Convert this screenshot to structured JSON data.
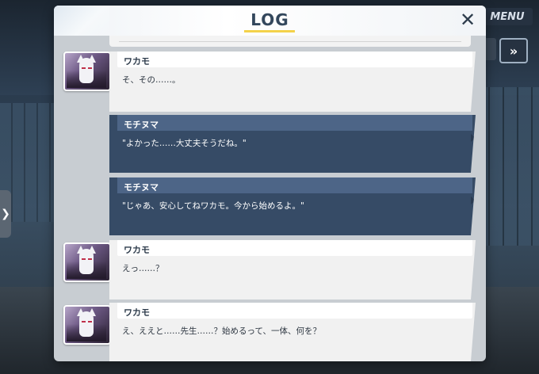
{
  "hud": {
    "menu_label": "MENU",
    "fast_forward_icon": "double-chevron-right-icon",
    "side_tab_glyph": "❯"
  },
  "log_modal": {
    "title": "LOG",
    "close_glyph": "✕",
    "accent_color": "#f4d24a"
  },
  "entries": [
    {
      "speaker": "ワカモ",
      "text": "そ、その……。",
      "style": "light",
      "avatar": "wakamo-fox-mask-avatar"
    },
    {
      "speaker": "モチヌマ",
      "text": "\"よかった……大丈夫そうだね。\"",
      "style": "dark"
    },
    {
      "speaker": "モチヌマ",
      "text": "\"じゃあ、安心してねワカモ。今から始めるよ。\"",
      "style": "dark"
    },
    {
      "speaker": "ワカモ",
      "text": "えっ……？",
      "style": "light",
      "avatar": "wakamo-fox-mask-avatar"
    },
    {
      "speaker": "ワカモ",
      "text": "え、ええと……先生……？始めるって、一体、何を？",
      "style": "light",
      "avatar": "wakamo-fox-mask-avatar"
    }
  ]
}
